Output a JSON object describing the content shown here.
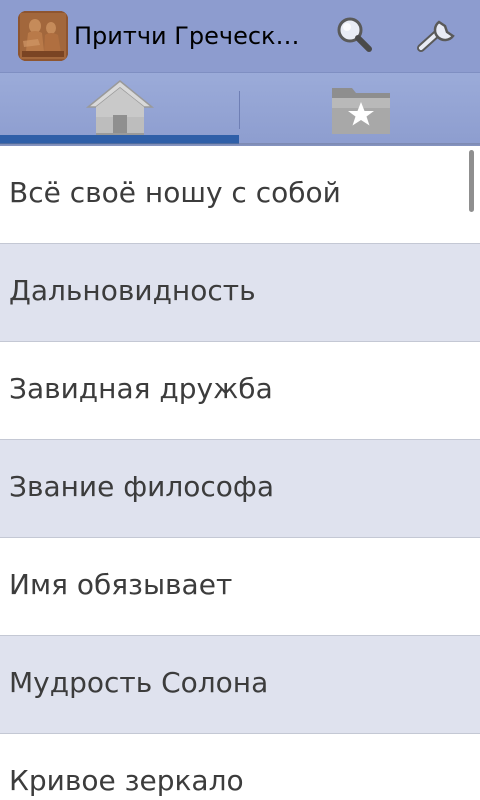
{
  "header": {
    "title": "Притчи Греческ…",
    "app_icon": "app-logo-icon",
    "actions": {
      "search_icon": "search-icon",
      "settings_icon": "wrench-icon"
    }
  },
  "tabs": [
    {
      "icon": "home-icon",
      "selected": true
    },
    {
      "icon": "favorites-folder-icon",
      "selected": false
    }
  ],
  "colors": {
    "action_bar": "#8d9ccf",
    "tab_indicator": "#2f5fa8",
    "row_alt": "#dfe2ee",
    "text": "#3c3c3c"
  },
  "list": {
    "items": [
      {
        "label": "Всё своё ношу с собой"
      },
      {
        "label": "Дальновидность"
      },
      {
        "label": "Завидная дружба"
      },
      {
        "label": "Звание философа"
      },
      {
        "label": "Имя обязывает"
      },
      {
        "label": "Мудрость Солона"
      },
      {
        "label": "Кривое зеркало"
      }
    ]
  }
}
